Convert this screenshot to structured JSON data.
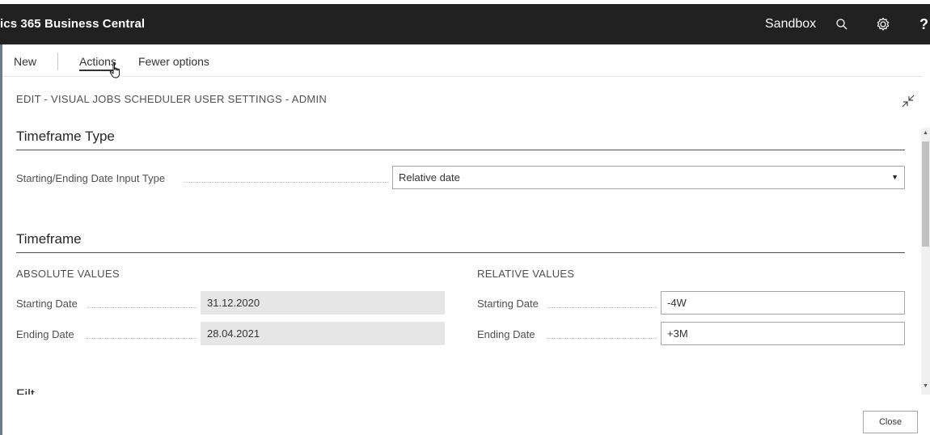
{
  "header": {
    "app_title": "ics 365 Business Central",
    "environment": "Sandbox",
    "search_icon": "search-icon",
    "settings_icon": "gear-icon",
    "help_label": "?"
  },
  "action_bar": {
    "new_label": "New",
    "actions_label": "Actions",
    "fewer_options_label": "Fewer options"
  },
  "page": {
    "caption": "EDIT - VISUAL JOBS SCHEDULER USER SETTINGS - ADMIN",
    "collapse_icon": "collapse-icon"
  },
  "timeframe_type": {
    "title": "Timeframe Type",
    "input_type_label": "Starting/Ending Date Input Type",
    "input_type_value": "Relative date"
  },
  "timeframe": {
    "title": "Timeframe",
    "absolute": {
      "caption": "ABSOLUTE VALUES",
      "starting_label": "Starting Date",
      "starting_value": "31.12.2020",
      "ending_label": "Ending Date",
      "ending_value": "28.04.2021"
    },
    "relative": {
      "caption": "RELATIVE VALUES",
      "starting_label": "Starting Date",
      "starting_value": "-4W",
      "ending_label": "Ending Date",
      "ending_value": "+3M"
    }
  },
  "next_section_partial": "Filt",
  "footer": {
    "close_label": "Close"
  },
  "colors": {
    "header_bg": "#212121",
    "header_text": "#ffffff",
    "readonly_bg": "#e6e6e6"
  }
}
